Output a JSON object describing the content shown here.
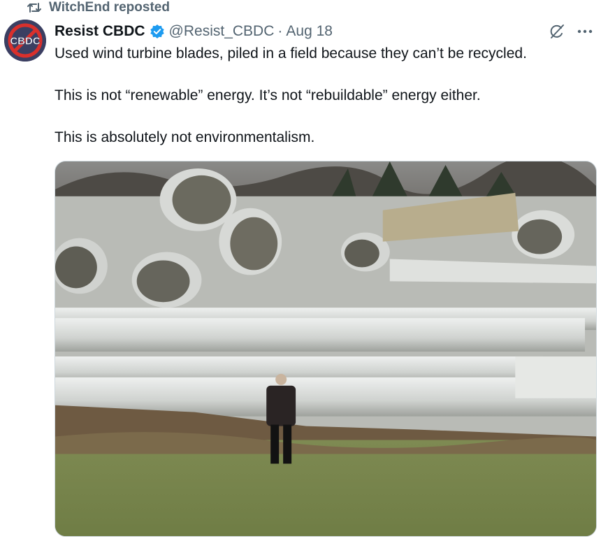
{
  "repost": {
    "label": "WitchEnd reposted"
  },
  "author": {
    "name": "Resist CBDC",
    "handle": "@Resist_CBDC",
    "date": "Aug 18",
    "avatar_text": "CBDC"
  },
  "tweet": {
    "paragraphs": [
      "Used wind turbine blades, piled in a field because they can’t be recycled.",
      "This is not “renewable” energy.  It’s not “rebuildable” energy either.",
      "This is absolutely not environmentalism."
    ]
  },
  "colors": {
    "text": "#0f1419",
    "secondary": "#536471",
    "verified": "#1d9bf0",
    "avatar_bg": "#3b3f62",
    "avatar_ring": "#d9302c"
  },
  "icons": {
    "repost": "repost-icon",
    "verified": "verified-badge-icon",
    "grok": "grok-icon",
    "more": "more-icon"
  }
}
